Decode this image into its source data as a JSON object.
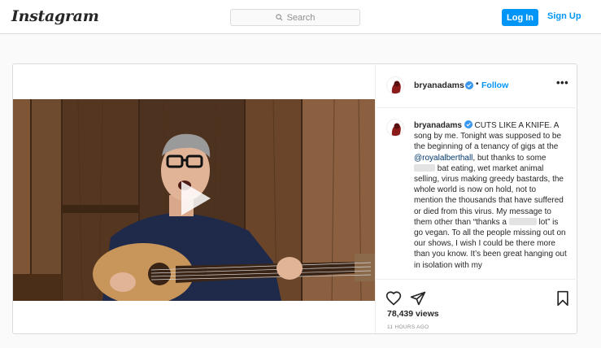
{
  "nav": {
    "logo": "Instagram",
    "search_placeholder": "Search",
    "login_label": "Log In",
    "signup_label": "Sign Up"
  },
  "post": {
    "username": "bryanadams",
    "follow_label": "Follow",
    "separator": "•",
    "more_label": "•••",
    "caption": {
      "username": "bryanadams",
      "p1": " CUTS LIKE A KNIFE. A song by me. Tonight was supposed to be the beginning of a tenancy of gigs at the ",
      "mention": "@royalalberthall",
      "p2": ", but thanks to some ",
      "p3": " bat eating, wet market animal selling, virus making greedy bastards, the whole world is now on hold, not to mention the thousands that have suffered or died from this virus. My message to them other than “thanks a ",
      "p4": " lot” is go vegan. To all the people missing out on our shows, I wish I could be there more than you know. It’s been great hanging out in isolation with my"
    },
    "views": "78,439 views",
    "time": "11 HOURS AGO"
  },
  "colors": {
    "accent": "#0095f6",
    "verified": "#3897f0",
    "border": "#dbdbdb",
    "background": "#fafafa"
  },
  "icons": {
    "search": "search-icon",
    "verified": "verified-badge-icon",
    "play": "play-icon",
    "like": "heart-icon",
    "share": "paper-plane-icon",
    "save": "bookmark-icon",
    "more": "more-options-icon"
  }
}
